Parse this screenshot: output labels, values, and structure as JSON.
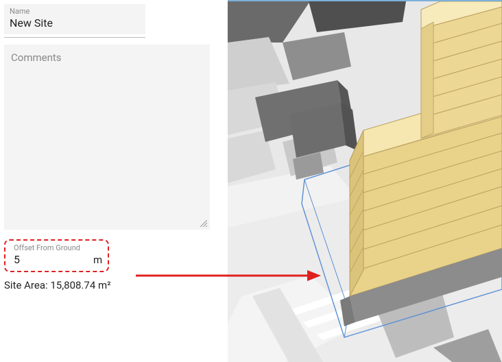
{
  "panel": {
    "name_label": "Name",
    "name_value": "New Site",
    "comments_placeholder": "Comments",
    "comments_value": "",
    "offset_label": "Offset From Ground",
    "offset_value": "5",
    "offset_unit": "m",
    "site_area_text": "Site Area: 15,808.74 m²"
  },
  "annotation": {
    "highlight_color": "#e02020"
  },
  "viewport": {
    "building_color": "#f5e2a0",
    "building_edge": "#b89f5e",
    "ground_color": "#e8e8e8",
    "context_dark": "#616161",
    "context_mid": "#9e9e9e",
    "context_light": "#cfcfcf",
    "selection_color": "#5a8fd6"
  }
}
